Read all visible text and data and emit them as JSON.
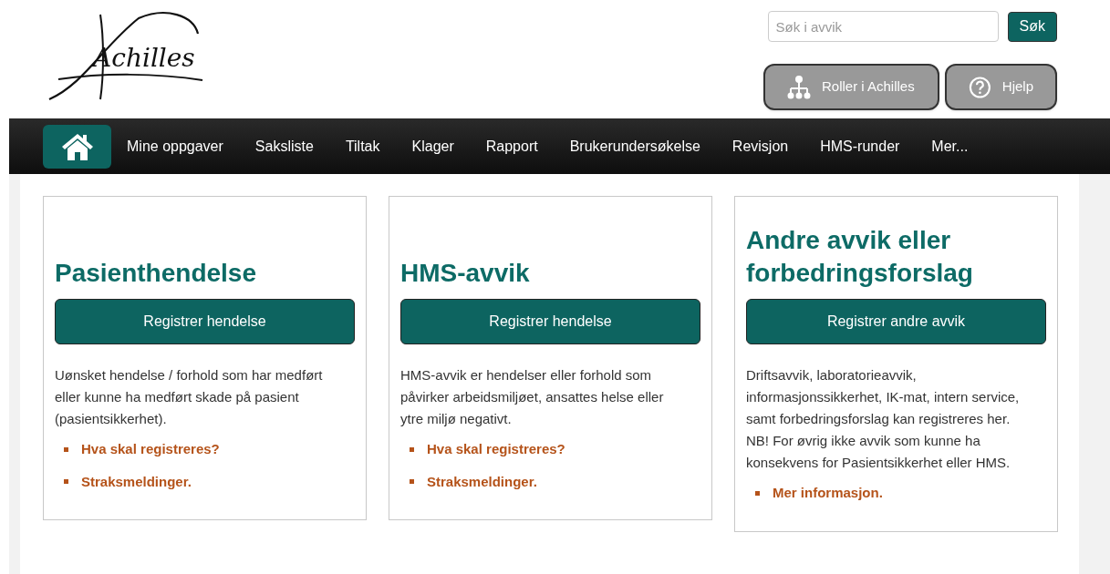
{
  "logo": {
    "text": "Achilles"
  },
  "search": {
    "placeholder": "Søk i avvik",
    "button": "Søk"
  },
  "header_buttons": [
    {
      "kind": "roles",
      "label": "Roller i Achilles"
    },
    {
      "kind": "help",
      "label": "Hjelp"
    }
  ],
  "nav": [
    {
      "kind": "home",
      "selected": true
    },
    {
      "label": "Mine oppgaver",
      "selected": false
    },
    {
      "label": "Saksliste",
      "selected": false
    },
    {
      "label": "Tiltak",
      "selected": false
    },
    {
      "label": "Klager",
      "selected": false
    },
    {
      "label": "Rapport",
      "selected": false
    },
    {
      "label": "Brukerundersøkelse",
      "selected": false
    },
    {
      "label": "Revisjon",
      "selected": false
    },
    {
      "label": "HMS-runder",
      "selected": false
    },
    {
      "label": "Mer...",
      "selected": false
    }
  ],
  "cards": [
    {
      "title": "Pasienthendelse",
      "button": "Registrer hendelse",
      "description": [
        "Uønsket hendelse / forhold som har medført eller kunne ha medført skade på pasient (pasientsikkerhet)."
      ],
      "links": [
        "Hva skal registreres?",
        "Straksmeldinger."
      ]
    },
    {
      "title": "HMS-avvik",
      "button": "Registrer hendelse",
      "description": [
        "HMS-avvik er hendelser eller forhold som påvirker arbeidsmiljøet, ansattes helse eller ytre miljø negativt."
      ],
      "links": [
        "Hva skal registreres?",
        "Straksmeldinger."
      ]
    },
    {
      "title": "Andre avvik eller forbedringsforslag",
      "button": "Registrer andre avvik",
      "description": [
        "Driftsavvik, laboratorieavvik, informasjonssikkerhet, IK-mat, intern service, samt forbedringsforslag kan registreres her.",
        "NB! For øvrig ikke avvik som kunne ha konsekvens for Pasientsikkerhet eller HMS."
      ],
      "links": [
        "Mer informasjon."
      ]
    }
  ]
}
